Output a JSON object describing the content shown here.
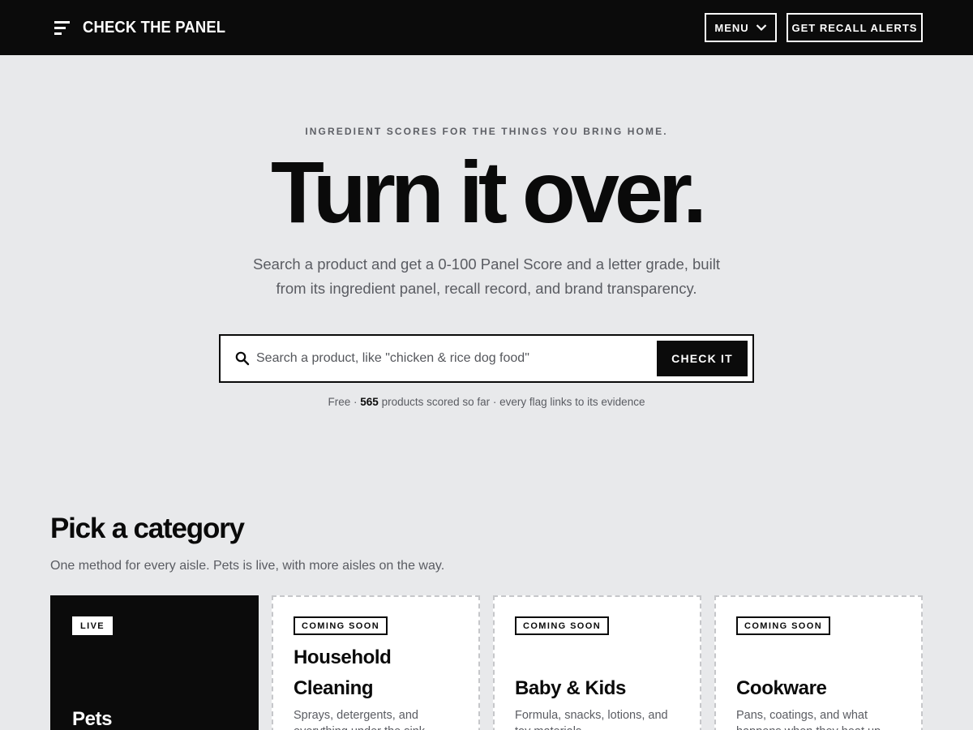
{
  "header": {
    "brand": "CHECK THE PANEL",
    "menu_label": "MENU",
    "alerts_label": "GET RECALL ALERTS"
  },
  "hero": {
    "eyebrow": "INGREDIENT SCORES FOR THE THINGS YOU BRING HOME.",
    "title": "Turn it over.",
    "subtitle": "Search a product and get a 0-100 Panel Score and a letter grade, built from its ingredient panel, recall record, and brand transparency."
  },
  "search": {
    "placeholder": "Search a product, like \"chicken & rice dog food\"",
    "button_label": "CHECK IT"
  },
  "meta": {
    "prefix": "Free · ",
    "count": "565",
    "suffix": " products scored so far · every flag links to its evidence"
  },
  "categories": {
    "title": "Pick a category",
    "subtitle": "One method for every aisle. Pets is live, with more aisles on the way.",
    "items": [
      {
        "badge": "LIVE",
        "title": "Pets",
        "description": ""
      },
      {
        "badge": "COMING SOON",
        "title": "Household Cleaning",
        "description": "Sprays, detergents, and everything under the sink."
      },
      {
        "badge": "COMING SOON",
        "title": "Baby & Kids",
        "description": "Formula, snacks, lotions, and toy materials."
      },
      {
        "badge": "COMING SOON",
        "title": "Cookware",
        "description": "Pans, coatings, and what happens when they heat up."
      }
    ]
  },
  "icons": {
    "brand": "brand-lines-icon",
    "menu": "chevron-down-icon",
    "search": "search-icon"
  },
  "colors": {
    "header_bg": "#0b0b0b",
    "page_bg": "#e8e9eb",
    "text": "#0a0a0a",
    "muted": "#5a5c62"
  }
}
